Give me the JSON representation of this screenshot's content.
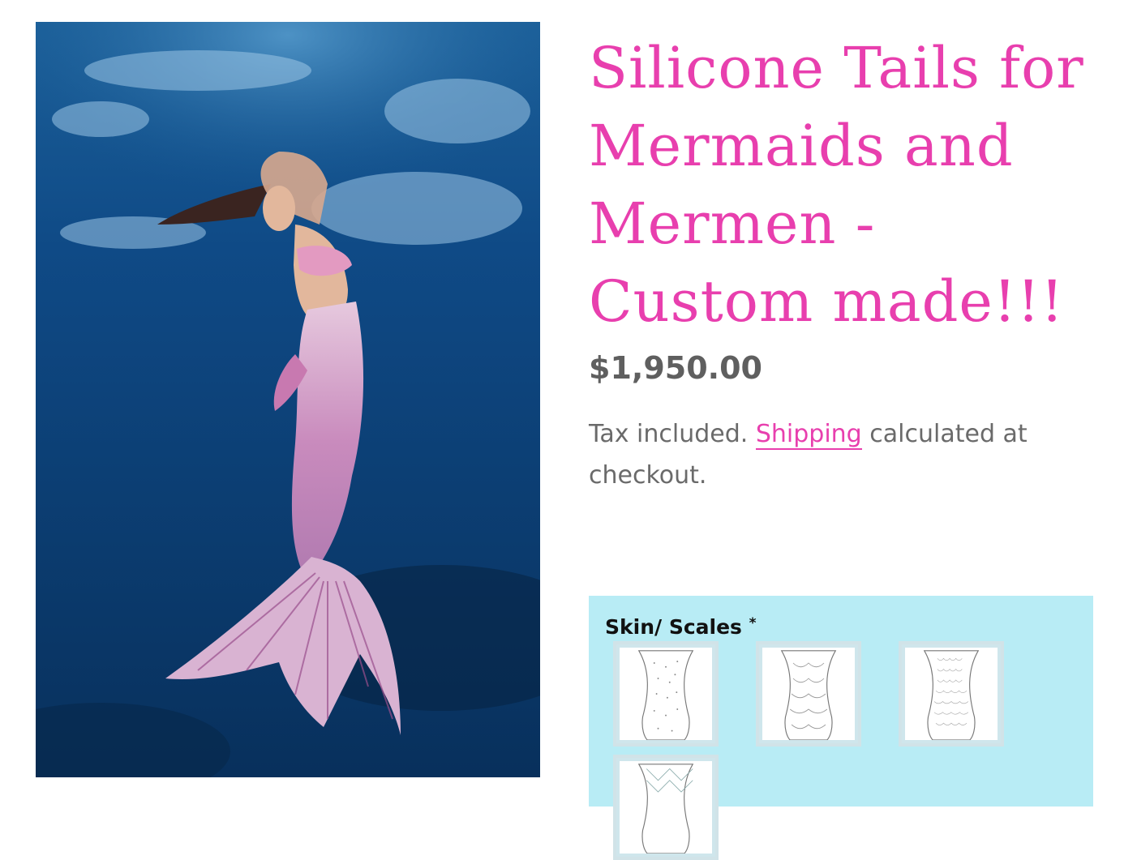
{
  "product": {
    "title": "Silicone Tails for Mermaids and Mermen - Custom made!!!",
    "price": "$1,950.00",
    "tax_text": "Tax included.",
    "shipping_link": "Shipping",
    "tax_suffix": "calculated at checkout."
  },
  "options": {
    "label": "Skin/ Scales",
    "required_mark": "*",
    "swatches": [
      {
        "pattern": "dots-icon"
      },
      {
        "pattern": "scales-large-icon"
      },
      {
        "pattern": "scales-small-icon"
      },
      {
        "pattern": "diamond-scales-icon"
      }
    ]
  },
  "colors": {
    "accent_pink": "#e83fae",
    "price_gray": "#5f5f5f",
    "options_bg": "#b8ecf5",
    "water_deep": "#0b3566"
  }
}
